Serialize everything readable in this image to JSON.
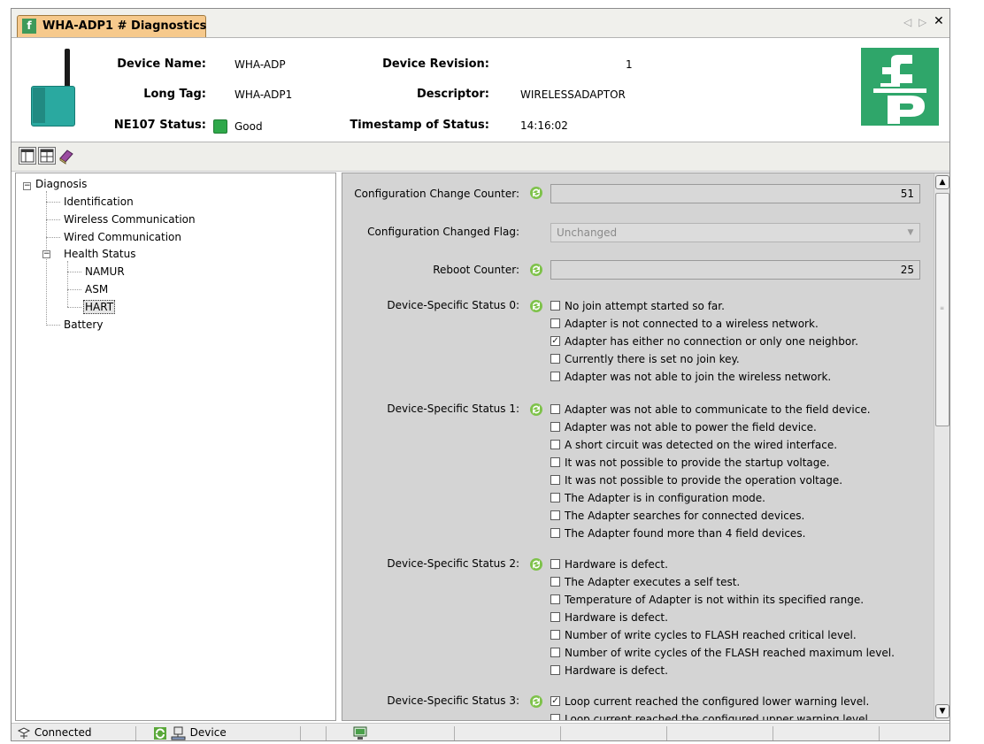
{
  "tab": {
    "title": "WHA-ADP1 # Diagnostics",
    "logo": "f̲"
  },
  "window_controls": {
    "prev": "◁",
    "next": "▷",
    "close": "✕"
  },
  "header": {
    "device_name_label": "Device Name:",
    "device_name": "WHA-ADP",
    "long_tag_label": "Long Tag:",
    "long_tag": "WHA-ADP1",
    "ne107_label": "NE107 Status:",
    "ne107_status": "Good",
    "device_revision_label": "Device Revision:",
    "device_revision": "1",
    "descriptor_label": "Descriptor:",
    "descriptor": "WIRELESSADAPTOR",
    "timestamp_label": "Timestamp of Status:",
    "timestamp": "14:16:02",
    "status_color": "#2fa84a",
    "brand_color": "#2fa66a"
  },
  "toolbar": {
    "icons": [
      "layout-icon",
      "split-layout-icon",
      "book-icon"
    ]
  },
  "tree": {
    "root": "Diagnosis",
    "items": [
      "Identification",
      "Wireless Communication",
      "Wired Communication"
    ],
    "health_status": "Health Status",
    "health_children": [
      "NAMUR",
      "ASM",
      "HART"
    ],
    "selected": "HART",
    "battery": "Battery"
  },
  "form": {
    "config_change_counter_label": "Configuration Change Counter:",
    "config_change_counter": "51",
    "config_changed_flag_label": "Configuration Changed Flag:",
    "config_changed_flag": "Unchanged",
    "reboot_counter_label": "Reboot Counter:",
    "reboot_counter": "25",
    "status_groups": [
      {
        "label": "Device-Specific Status 0:",
        "items": [
          {
            "text": "No join attempt started so far.",
            "checked": false
          },
          {
            "text": "Adapter is not connected to a wireless network.",
            "checked": false
          },
          {
            "text": "Adapter has either no connection or only one neighbor.",
            "checked": true
          },
          {
            "text": "Currently there is set no join key.",
            "checked": false
          },
          {
            "text": "Adapter was not able to join the wireless network.",
            "checked": false
          }
        ]
      },
      {
        "label": "Device-Specific Status 1:",
        "items": [
          {
            "text": "Adapter was not able to communicate to the field device.",
            "checked": false
          },
          {
            "text": "Adapter was not able to power the field device.",
            "checked": false
          },
          {
            "text": "A short circuit was detected on the wired interface.",
            "checked": false
          },
          {
            "text": "It was not possible to provide the startup voltage.",
            "checked": false
          },
          {
            "text": "It was not possible to provide the operation voltage.",
            "checked": false
          },
          {
            "text": "The Adapter is in configuration mode.",
            "checked": false
          },
          {
            "text": "The Adapter searches for connected devices.",
            "checked": false
          },
          {
            "text": "The Adapter found more than 4 field devices.",
            "checked": false
          }
        ]
      },
      {
        "label": "Device-Specific Status 2:",
        "items": [
          {
            "text": "Hardware is defect.",
            "checked": false
          },
          {
            "text": "The Adapter executes a self test.",
            "checked": false
          },
          {
            "text": "Temperature of Adapter is not within its specified range.",
            "checked": false
          },
          {
            "text": "Hardware is defect.",
            "checked": false
          },
          {
            "text": "Number of write cycles to FLASH reached critical level.",
            "checked": false
          },
          {
            "text": "Number of write cycles of the FLASH reached maximum level.",
            "checked": false
          },
          {
            "text": "Hardware is defect.",
            "checked": false
          }
        ]
      },
      {
        "label": "Device-Specific Status 3:",
        "items": [
          {
            "text": "Loop current reached the configured lower warning level.",
            "checked": true
          },
          {
            "text": "Loop current reached the configured upper warning level.",
            "checked": false
          }
        ]
      }
    ]
  },
  "statusbar": {
    "connected": "Connected",
    "device": "Device"
  }
}
